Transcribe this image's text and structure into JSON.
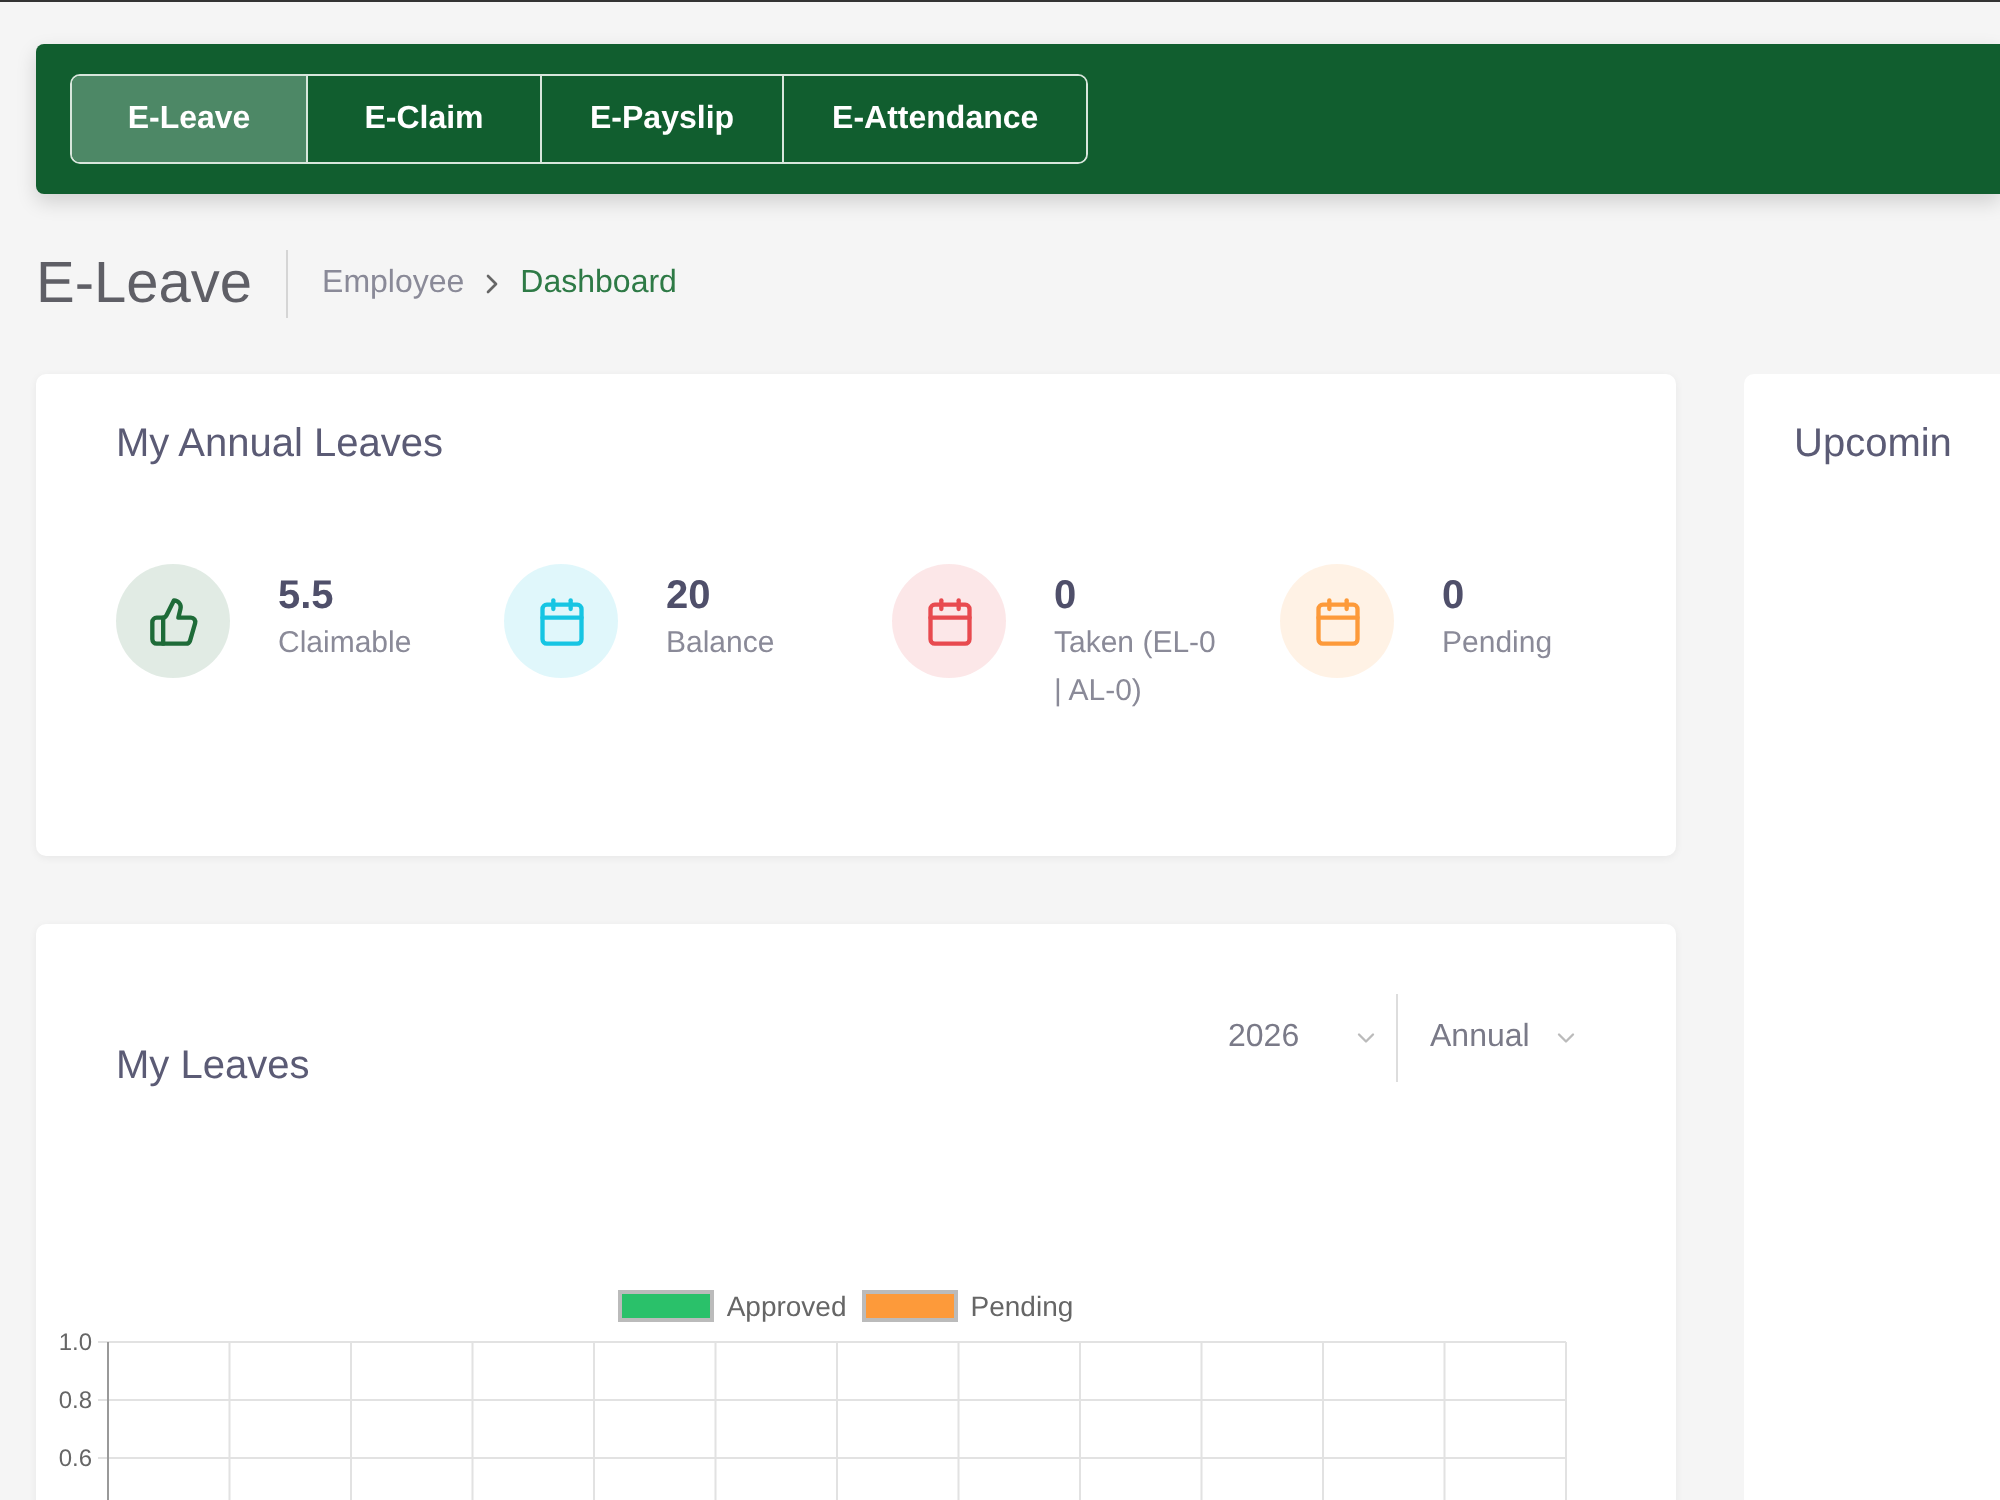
{
  "nav_tabs": [
    {
      "label": "E-Leave",
      "selected": true
    },
    {
      "label": "E-Claim",
      "selected": false
    },
    {
      "label": "E-Payslip",
      "selected": false
    },
    {
      "label": "E-Attendance",
      "selected": false
    }
  ],
  "page_title": "E-Leave",
  "breadcrumb": [
    {
      "label": "Employee",
      "selected": false
    },
    {
      "label": "Dashboard",
      "selected": true
    }
  ],
  "annual_leaves": {
    "title": "My Annual Leaves",
    "stats": [
      {
        "kind": "thumb",
        "color": "#1e6b38",
        "value": "5.5",
        "label": "Claimable"
      },
      {
        "kind": "calendar",
        "color": "#16c5e3",
        "value": "20",
        "label": "Balance"
      },
      {
        "kind": "calendar",
        "color": "#e84a4f",
        "value": "0",
        "label": "Taken (EL-0 | AL-0)"
      },
      {
        "kind": "calendar",
        "color": "#fd9a3a",
        "value": "0",
        "label": "Pending"
      }
    ]
  },
  "my_leaves": {
    "title": "My Leaves",
    "filters": [
      {
        "value": "2026"
      },
      {
        "value": "Annual"
      }
    ],
    "chart_data": {
      "type": "bar",
      "ylim": [
        0,
        1
      ],
      "yticks": [
        {
          "value": 0.6,
          "label": "0.6"
        },
        {
          "value": 0.8,
          "label": "0.8"
        },
        {
          "value": 1,
          "label": "1.0"
        }
      ],
      "series": [
        {
          "name": "Approved",
          "color": "#2ac16a",
          "values": [
            null,
            null,
            null,
            null,
            null,
            null,
            null,
            null,
            null,
            null,
            null,
            null
          ]
        },
        {
          "name": "Pending",
          "color": "#fd9a3a",
          "values": [
            null,
            null,
            null,
            null,
            null,
            null,
            null,
            null,
            null,
            null,
            null,
            null
          ]
        }
      ]
    }
  },
  "upcoming": {
    "title": "Upcomin"
  }
}
